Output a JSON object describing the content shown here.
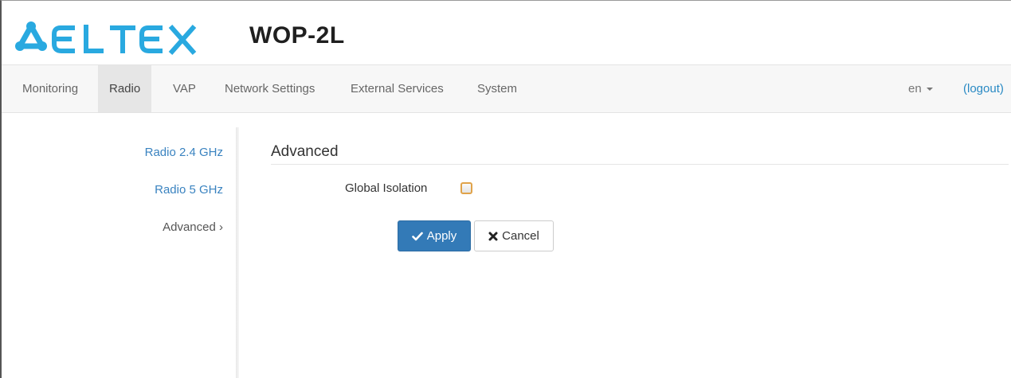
{
  "header": {
    "brand": "ELTEX",
    "product": "WOP-2L"
  },
  "nav": {
    "items": [
      {
        "label": "Monitoring",
        "active": false
      },
      {
        "label": "Radio",
        "active": true
      },
      {
        "label": "VAP",
        "active": false
      },
      {
        "label": "Network Settings",
        "active": false
      },
      {
        "label": "External Services",
        "active": false
      },
      {
        "label": "System",
        "active": false
      }
    ],
    "language": "en",
    "logout": "(logout)"
  },
  "sidebar": {
    "items": [
      {
        "label": "Radio 2.4 GHz",
        "current": false
      },
      {
        "label": "Radio 5 GHz",
        "current": false
      },
      {
        "label": "Advanced ›",
        "current": true
      }
    ]
  },
  "main": {
    "section_title": "Advanced",
    "global_isolation": {
      "label": "Global Isolation",
      "checked": false
    },
    "apply_label": "Apply",
    "cancel_label": "Cancel"
  },
  "colors": {
    "brand": "#29a9e0",
    "link": "#3a83c0",
    "primary_button": "#337ab7"
  }
}
